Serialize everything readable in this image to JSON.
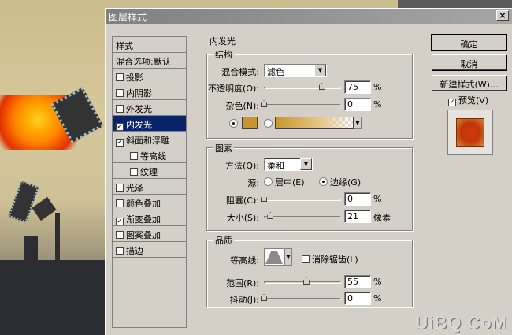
{
  "dialog": {
    "title": "图层样式",
    "close_label": "×"
  },
  "style_list": {
    "header": "样式",
    "items": [
      {
        "label": "混合选项:默认",
        "checkbox": false,
        "checked": false,
        "indent": false,
        "active": false
      },
      {
        "label": "投影",
        "checkbox": true,
        "checked": false,
        "indent": false,
        "active": false
      },
      {
        "label": "内阴影",
        "checkbox": true,
        "checked": false,
        "indent": false,
        "active": false
      },
      {
        "label": "外发光",
        "checkbox": true,
        "checked": false,
        "indent": false,
        "active": false
      },
      {
        "label": "内发光",
        "checkbox": true,
        "checked": true,
        "indent": false,
        "active": true
      },
      {
        "label": "斜面和浮雕",
        "checkbox": true,
        "checked": true,
        "indent": false,
        "active": false
      },
      {
        "label": "等高线",
        "checkbox": true,
        "checked": false,
        "indent": true,
        "active": false
      },
      {
        "label": "纹理",
        "checkbox": true,
        "checked": false,
        "indent": true,
        "active": false
      },
      {
        "label": "光泽",
        "checkbox": true,
        "checked": false,
        "indent": false,
        "active": false
      },
      {
        "label": "颜色叠加",
        "checkbox": true,
        "checked": false,
        "indent": false,
        "active": false
      },
      {
        "label": "渐变叠加",
        "checkbox": true,
        "checked": true,
        "indent": false,
        "active": false
      },
      {
        "label": "图案叠加",
        "checkbox": true,
        "checked": false,
        "indent": false,
        "active": false
      },
      {
        "label": "描边",
        "checkbox": true,
        "checked": false,
        "indent": false,
        "active": false
      }
    ]
  },
  "panel": {
    "title": "内发光",
    "structure": {
      "label": "结构",
      "blend_mode_label": "混合模式:",
      "blend_mode_value": "滤色",
      "opacity_label": "不透明度(O):",
      "opacity_value": "75",
      "opacity_fraction": 0.75,
      "noise_label": "杂色(N):",
      "noise_value": "0",
      "noise_fraction": 0.0,
      "percent": "%",
      "glow_color": "#c8962a"
    },
    "elements": {
      "label": "图素",
      "method_label": "方法(Q):",
      "method_value": "柔和",
      "source_label": "源:",
      "source_center": "居中(E)",
      "source_edge": "边缘(G)",
      "choke_label": "阻塞(C):",
      "choke_value": "0",
      "choke_fraction": 0.0,
      "size_label": "大小(S):",
      "size_value": "21",
      "size_fraction": 0.085,
      "size_unit": "像素"
    },
    "quality": {
      "label": "品质",
      "contour_label": "等高线:",
      "antialias_label": "消除锯齿(L)",
      "range_label": "范围(R):",
      "range_value": "55",
      "range_fraction": 0.55,
      "jitter_label": "抖动(J):",
      "jitter_value": "0",
      "jitter_fraction": 0.0
    }
  },
  "buttons": {
    "ok": "确定",
    "cancel": "取消",
    "new_style": "新建样式(W)...",
    "preview_label": "预览(V)"
  },
  "watermark": "UiBQ.CoM"
}
